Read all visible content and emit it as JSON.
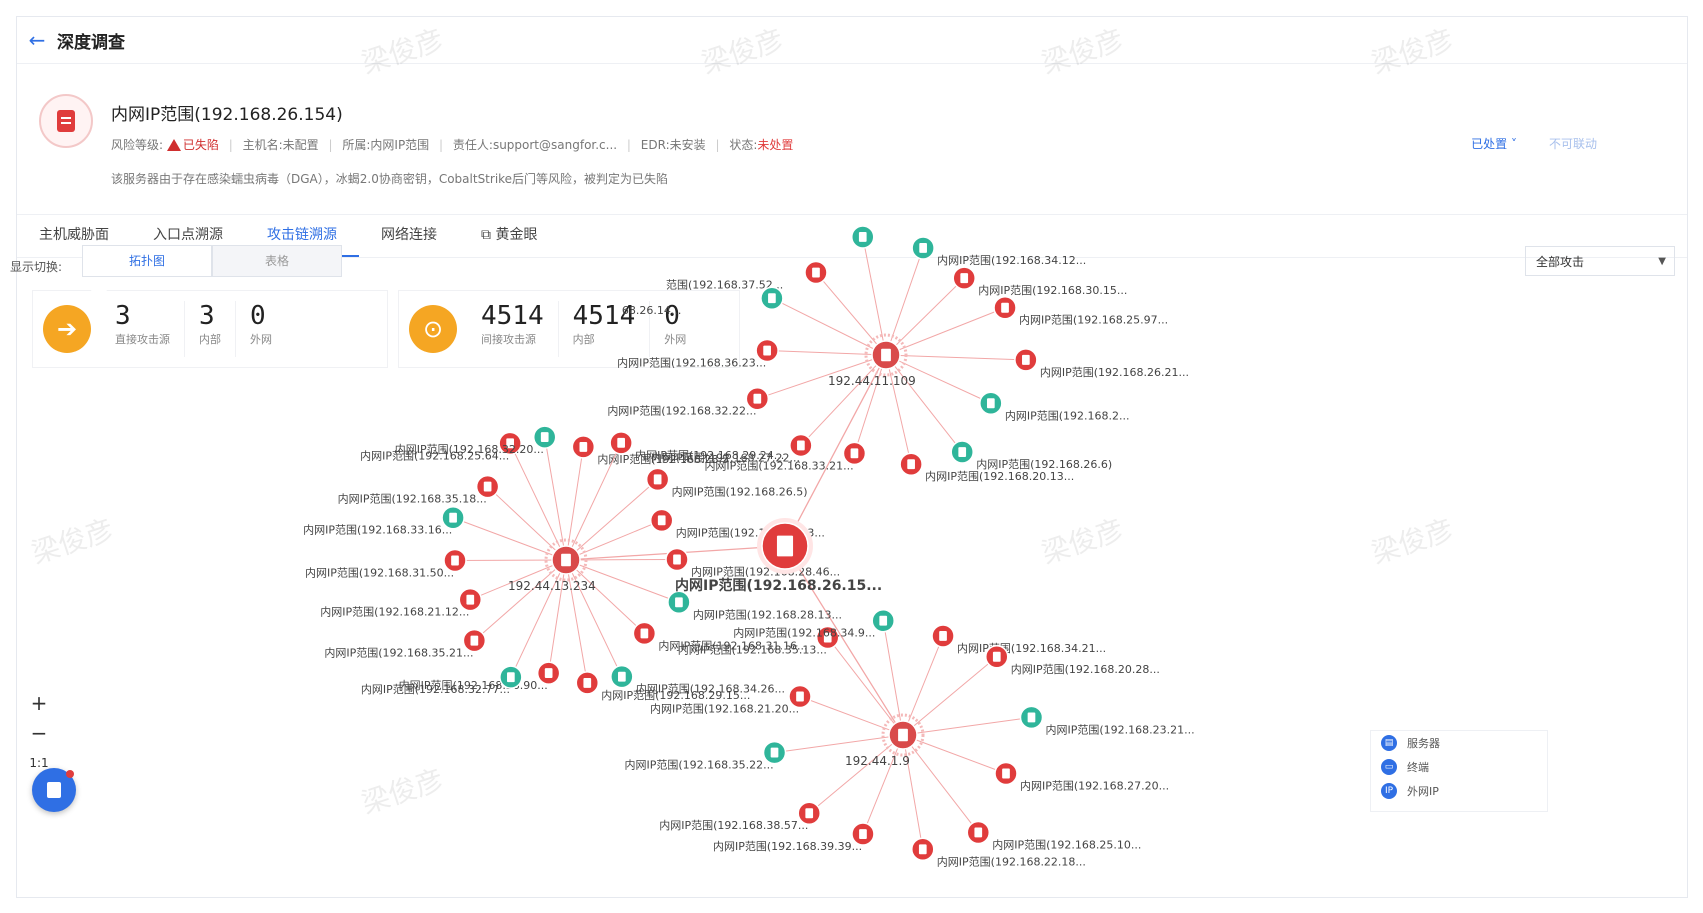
{
  "header": {
    "title": "深度调查"
  },
  "host": {
    "name": "内网IP范围(192.168.26.154)",
    "risk_label": "风险等级:",
    "risk_value": "已失陷",
    "hostname_label": "主机名:",
    "hostname_value": "未配置",
    "belong_label": "所属:",
    "belong_value": "内网IP范围",
    "owner_label": "责任人:",
    "owner_value": "support@sangfor.c...",
    "edr_label": "EDR:",
    "edr_value": "未安装",
    "status_label": "状态:",
    "status_value": "未处置",
    "description": "该服务器由于存在感染蠕虫病毒（DGA），冰蝎2.0协商密钥，CobaltStrike后门等风险，被判定为已失陷",
    "handled_label": "已处置",
    "notlink_label": "不可联动"
  },
  "tabs": [
    {
      "label": "主机威胁面"
    },
    {
      "label": "入口点溯源"
    },
    {
      "label": "攻击链溯源"
    },
    {
      "label": "网络连接"
    },
    {
      "label": "黄金眼"
    }
  ],
  "view_switch": {
    "label": "显示切换:",
    "options": [
      "拓扑图",
      "表格"
    ]
  },
  "filter": {
    "value": "全部攻击"
  },
  "stats_direct": {
    "total": "3",
    "total_label": "直接攻击源",
    "internal": "3",
    "internal_label": "内部",
    "external": "0",
    "external_label": "外网"
  },
  "stats_indirect": {
    "total": "4514",
    "total_label": "间接攻击源",
    "internal": "4514",
    "internal_label": "内部",
    "external": "0",
    "external_label": "外网"
  },
  "zoom": {
    "plus": "+",
    "minus": "−",
    "ratio": "1:1"
  },
  "legend": [
    {
      "label": "服务器",
      "icon": "server-icon"
    },
    {
      "label": "终端",
      "icon": "terminal-icon"
    },
    {
      "label": "外网IP",
      "icon": "ip-icon"
    }
  ],
  "watermark": "梁俊彦",
  "colors": {
    "accent": "#2f6fe4",
    "danger": "#e03c3c",
    "safe": "#2fb59a",
    "hub": "#d94a4a",
    "edge": "#f2a7a7"
  },
  "graph": {
    "target_label": "内网IP范围(192.168.26.15...",
    "hubs": [
      {
        "label": "192.44.11.109",
        "leaves": [
          {
            "t": "r",
            "label": "范围(192.168.37.52..."
          },
          {
            "t": "g",
            "label": ""
          },
          {
            "t": "g",
            "label": "内网IP范围(192.168.34.12..."
          },
          {
            "t": "r",
            "label": "内网IP范围(192.168.30.15..."
          },
          {
            "t": "r",
            "label": "内网IP范围(192.168.25.97..."
          },
          {
            "t": "r",
            "label": "内网IP范围(192.168.26.21..."
          },
          {
            "t": "g",
            "label": "内网IP范围(192.168.2..."
          },
          {
            "t": "g",
            "label": "内网IP范围(192.168.26.6)"
          },
          {
            "t": "r",
            "label": "内网IP范围(192.168.20.13..."
          },
          {
            "t": "r",
            "label": "内网IP范围(192.168.33.21..."
          },
          {
            "t": "r",
            "label": "内网IP范围(192.168.27.22..."
          },
          {
            "t": "r",
            "label": "内网IP范围(192.168.32.22..."
          },
          {
            "t": "r",
            "label": "内网IP范围(192.168.36.23..."
          },
          {
            "t": "g",
            "label": "68.26.14..."
          }
        ]
      },
      {
        "label": "192.44.13.234",
        "leaves": [
          {
            "t": "r",
            "label": "内网IP范围(192.168.28.5..."
          },
          {
            "t": "r",
            "label": "内网IP范围(192.168.29.24..."
          },
          {
            "t": "r",
            "label": "内网IP范围(192.168.26.5)"
          },
          {
            "t": "r",
            "label": "内网IP范围(192.168.20.23..."
          },
          {
            "t": "r",
            "label": "内网IP范围(192.168.28.46..."
          },
          {
            "t": "g",
            "label": "内网IP范围(192.168.28.13..."
          },
          {
            "t": "r",
            "label": "内网IP范围(192.168.31.16..."
          },
          {
            "t": "g",
            "label": "内网IP范围(192.168.34.26..."
          },
          {
            "t": "r",
            "label": "内网IP范围(192.168.29.15..."
          },
          {
            "t": "r",
            "label": "内网IP范围(192.168.36.90..."
          },
          {
            "t": "g",
            "label": "内网IP范围(192.168.32.77..."
          },
          {
            "t": "r",
            "label": "内网IP范围(192.168.35.21..."
          },
          {
            "t": "r",
            "label": "内网IP范围(192.168.21.12..."
          },
          {
            "t": "r",
            "label": "内网IP范围(192.168.31.50..."
          },
          {
            "t": "g",
            "label": "内网IP范围(192.168.33.16..."
          },
          {
            "t": "r",
            "label": "内网IP范围(192.168.35.18..."
          },
          {
            "t": "r",
            "label": "内网IP范围(192.168.25.64..."
          },
          {
            "t": "g",
            "label": "内网IP范围(192.168.32.20..."
          }
        ]
      },
      {
        "label": "192.44.1.9",
        "leaves": [
          {
            "t": "r",
            "label": "内网IP范围(192.168.34.21..."
          },
          {
            "t": "r",
            "label": "内网IP范围(192.168.20.28..."
          },
          {
            "t": "g",
            "label": "内网IP范围(192.168.23.21..."
          },
          {
            "t": "r",
            "label": "内网IP范围(192.168.27.20..."
          },
          {
            "t": "r",
            "label": "内网IP范围(192.168.25.10..."
          },
          {
            "t": "r",
            "label": "内网IP范围(192.168.22.18..."
          },
          {
            "t": "r",
            "label": "内网IP范围(192.168.39.39..."
          },
          {
            "t": "r",
            "label": "内网IP范围(192.168.38.57..."
          },
          {
            "t": "g",
            "label": "内网IP范围(192.168.35.22..."
          },
          {
            "t": "r",
            "label": "内网IP范围(192.168.21.20..."
          },
          {
            "t": "r",
            "label": "内网IP范围(192.168.35.13..."
          },
          {
            "t": "g",
            "label": "内网IP范围(192.168.34.9..."
          }
        ]
      }
    ]
  }
}
